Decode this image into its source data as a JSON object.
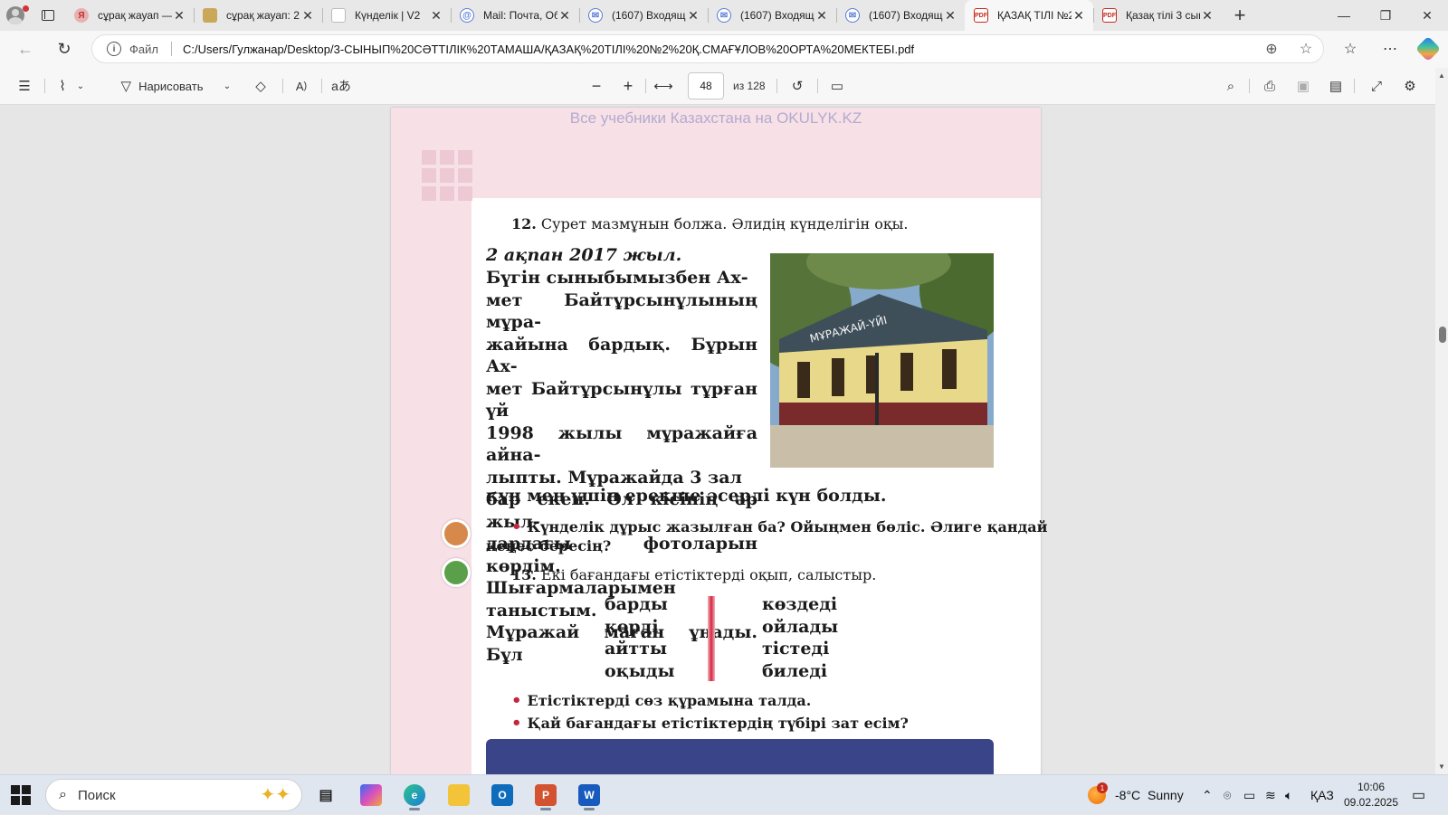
{
  "tabs": [
    {
      "title": "сұрақ жауап — ",
      "favicon": "yandex-icon",
      "active": false
    },
    {
      "title": "сұрақ жауап: 2 ",
      "favicon": "image-icon",
      "active": false
    },
    {
      "title": "Күнделік | V2",
      "favicon": "doc-icon",
      "active": false
    },
    {
      "title": "Mail: Почта, Об",
      "favicon": "mail-icon",
      "active": false
    },
    {
      "title": "(1607) Входящи",
      "favicon": "mail-icon",
      "active": false
    },
    {
      "title": "(1607) Входящи",
      "favicon": "mail-icon",
      "active": false
    },
    {
      "title": "(1607) Входящи",
      "favicon": "mail-icon",
      "active": false
    },
    {
      "title": "ҚАЗАҚ ТІЛІ №2",
      "favicon": "pdf-icon",
      "active": true
    },
    {
      "title": "Қазақ тілі 3 сын",
      "favicon": "pdf-icon",
      "active": false
    }
  ],
  "address": {
    "file_label": "Файл",
    "url": "C:/Users/Гулжанар/Desktop/3-СЫНЫП%20СӘТТІЛІК%20ТАМАША/ҚАЗАҚ%20ТІЛІ%20№2%20Қ.СМАҒҰЛОВ%20ОРТА%20МЕКТЕБІ.pdf"
  },
  "pdf_toolbar": {
    "draw_label": "Нарисовать",
    "page_current": "48",
    "page_total": "из 128"
  },
  "pdf_page": {
    "watermark": "Все учебники Казахстана на OKULYK.KZ",
    "task12_num": "12.",
    "task12_text": " Сурет мазмұнын болжа. Әлидің күнделігін оқы.",
    "date": "2 ақпан 2017 жыл.",
    "diary_text": "    Бүгін сыныбымызбен Ах-\nмет Байтұрсынұлының мұра-\nжайына бардық. Бұрын Ах-\nмет Байтұрсынұлы тұрған үй\n1998 жылы мұражайға айна-\nлыпты. Мұражайда 3 зал\nбар екен. Ол кісінің әр жыл-\nдардағы фотоларын көрдім.\nШығармаларымен таныстым.\nМұражай маған ұнады. Бұл",
    "diary_last": "күн мен үшін ерекше әсерлі күн болды.",
    "photo_sign": "МҰРАЖАЙ-ҮЙІ",
    "question1_line1": "Күнделік дұрыс жазылған ба? Ойыңмен бөліс. Әлиге қандай",
    "question1_line2": "кеңес бересің?",
    "task13_num": "13.",
    "task13_text": " Екі бағандағы етістіктерді оқып, салыстыр.",
    "col_left": [
      "барды",
      "көрді",
      "айтты",
      "оқыды"
    ],
    "col_right": [
      "көздеді",
      "ойлады",
      "тістеді",
      "биледі"
    ],
    "bullet2": "Етістіктерді сөз құрамына талда.",
    "bullet3": "Қай бағандағы етістіктердің түбірі зат есім?"
  },
  "taskbar": {
    "search_placeholder": "Поиск",
    "weather_badge": "1",
    "temperature": "-8°C",
    "weather": "Sunny",
    "lang": "ҚАЗ",
    "time": "10:06",
    "date": "09.02.2025"
  },
  "colors": {
    "pink_band": "#f7e1e7",
    "bullet_red": "#c2273d",
    "blue_box": "#3a4488"
  }
}
